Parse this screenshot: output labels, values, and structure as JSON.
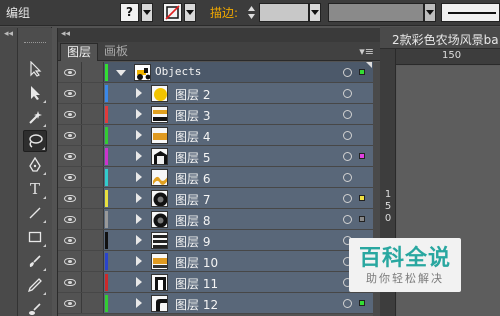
{
  "control_bar": {
    "group_label": "编组",
    "question_mark": "?",
    "stroke_label": "描边:",
    "accent_color": "#f0a800"
  },
  "layers_panel": {
    "tabs": [
      {
        "label": "图层",
        "active": true
      },
      {
        "label": "画板",
        "active": false
      }
    ],
    "menu_icon": "panel-menu-icon",
    "top_layer": {
      "name": "Objects",
      "expanded": true
    },
    "rows": [
      {
        "name": "图层 2",
        "color": "#3a88e8",
        "thumb": "circle-yellow",
        "selected": false
      },
      {
        "name": "图层 3",
        "color": "#e03b3b",
        "thumb": "stripes-orange",
        "selected": false
      },
      {
        "name": "图层 4",
        "color": "#33cc33",
        "thumb": "bar-orange",
        "selected": false
      },
      {
        "name": "图层 5",
        "color": "#cc33cc",
        "thumb": "shed",
        "selected": true,
        "sel_color": "#e040e0"
      },
      {
        "name": "图层 6",
        "color": "#33cccc",
        "thumb": "wave-orange",
        "selected": false
      },
      {
        "name": "图层 7",
        "color": "#e8e040",
        "thumb": "wheel",
        "selected": true,
        "sel_color": "#f0e040"
      },
      {
        "name": "图层 8",
        "color": "#999999",
        "thumb": "wheel",
        "selected": true,
        "sel_color": "#888888"
      },
      {
        "name": "图层 9",
        "color": "#111111",
        "thumb": "stripes-dark",
        "selected": false
      },
      {
        "name": "图层 10",
        "color": "#2a44cc",
        "thumb": "bar-orange-2",
        "selected": false
      },
      {
        "name": "图层 11",
        "color": "#cc2a2a",
        "thumb": "door",
        "selected": false
      },
      {
        "name": "图层 12",
        "color": "#33cc33",
        "thumb": "pipe",
        "selected": true,
        "sel_color": "#33dd33"
      }
    ],
    "objects_sel_color": "#33dd33"
  },
  "canvas": {
    "doc_tab": "2款彩色农场风景ba",
    "ruler_h": "150",
    "ruler_v": [
      "1",
      "5",
      "0"
    ]
  },
  "watermark": {
    "title": "百科全说",
    "subtitle": "助你轻松解决"
  }
}
